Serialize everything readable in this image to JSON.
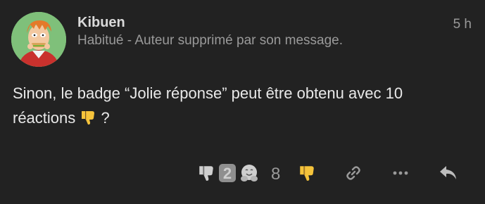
{
  "post": {
    "author": {
      "username": "Kibuen",
      "title": "Habitué - Auteur supprimé par son message."
    },
    "date": "5 h",
    "body_line1": "Sinon, le badge “Jolie réponse” peut être obtenu avec 10",
    "body_line2_before": "réactions",
    "body_line2_after": "?",
    "inline_emoji": "thumbs-down-yellow"
  },
  "reactions": {
    "summary_icons": [
      "thumbs-down-gray",
      "two-gray",
      "hugging-face-gray"
    ],
    "count": "8",
    "my_reaction": "thumbs-down-yellow"
  },
  "actions": [
    "link-icon",
    "more-icon",
    "reply-icon"
  ],
  "colors": {
    "background": "#222222",
    "emoji_yellow": "#f5c33b",
    "muted_text": "#9a9a9a"
  }
}
